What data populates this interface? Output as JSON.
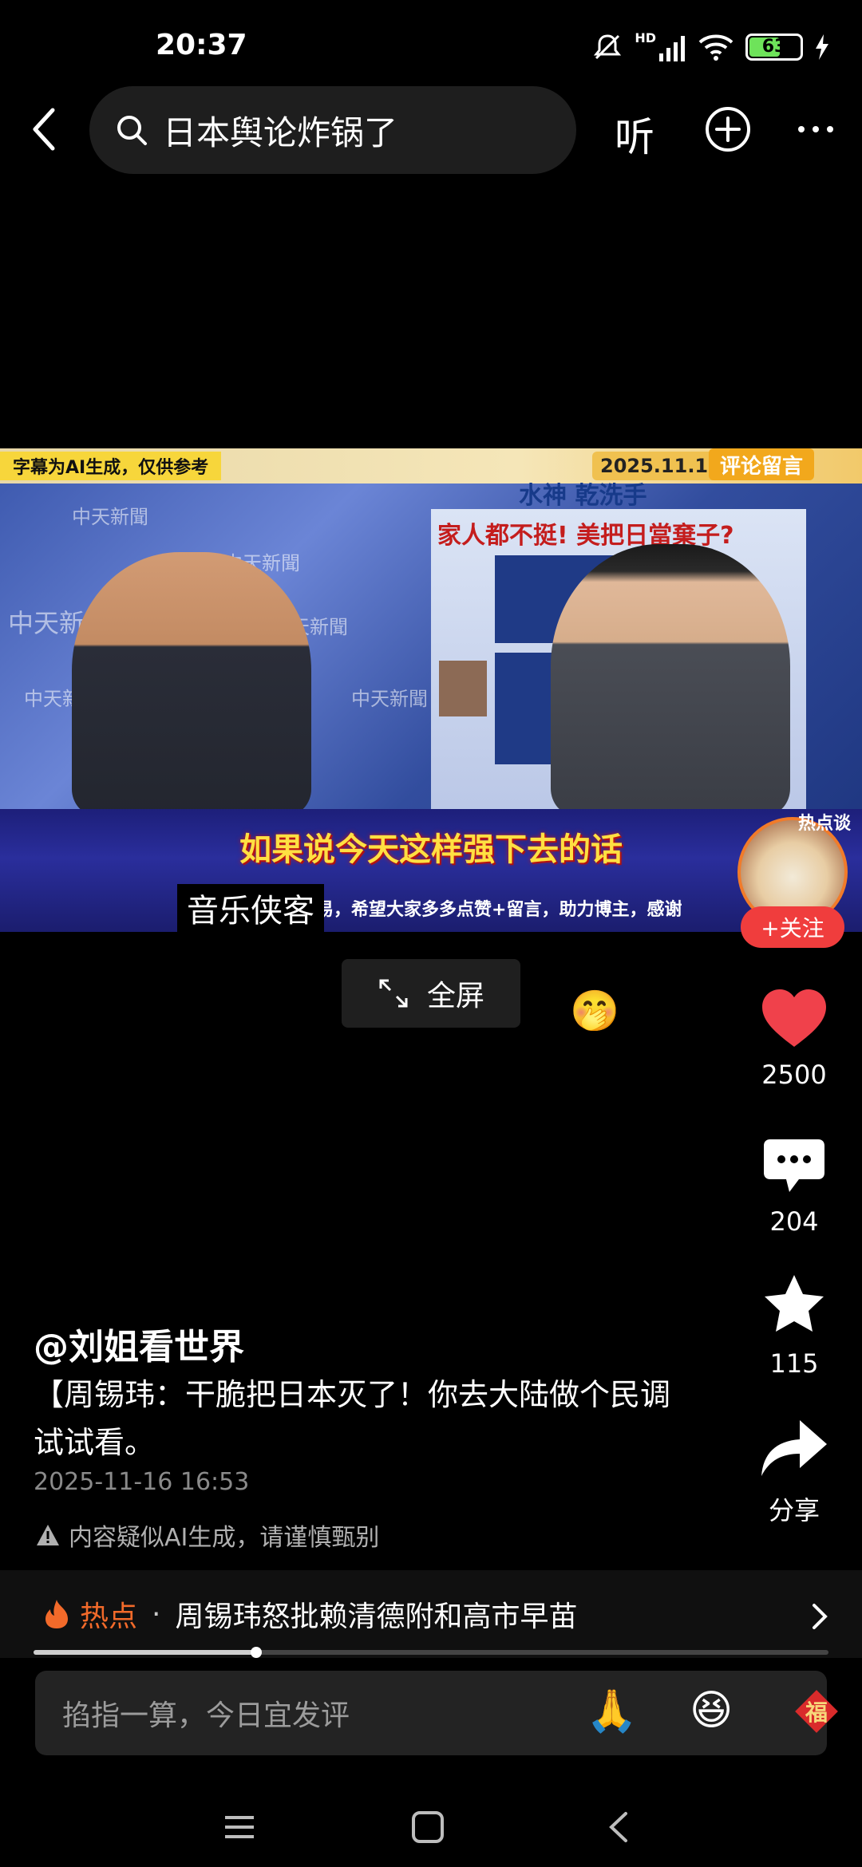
{
  "status_bar": {
    "time": "20:37",
    "network_label": "HD",
    "battery_level": 63,
    "battery_text": "63",
    "icons": [
      "mute-bell-icon",
      "signal-icon",
      "wifi-icon",
      "battery-icon",
      "charging-icon"
    ]
  },
  "header": {
    "back_icon": "chevron-left-icon",
    "search_icon": "search-icon",
    "search_query": "日本舆论炸锅了",
    "listen_label": "听",
    "add_icon": "plus-circle-icon",
    "more_icon": "more-dots-icon"
  },
  "video": {
    "ai_note": "字幕为AI生成，仅供参考",
    "date": "2025.11.14",
    "comment_tag": "评论留言",
    "sponsor": "水神 乾洗手",
    "channel": "中天新聞",
    "panel_title": "家人都不挺! 美把日當棄子?",
    "subtitle": "如果说今天这样强下去的话",
    "notice": "认准原创: 创作不易，希望大家多多点赞+留言，助力博主，感谢",
    "overlay_name": "音乐侠客",
    "hot_avatar_tag": "热点谈",
    "follow_label": "+关注",
    "fullscreen_label": "全屏",
    "colors": {
      "subtitle_yellow": "#ffe042",
      "banner_blue": "#1d1f7a",
      "follow_red": "#f03d3d"
    }
  },
  "actions": {
    "like": {
      "icon": "heart-icon",
      "count": "2500",
      "color": "#f0414b"
    },
    "comment": {
      "icon": "comment-bubble-icon",
      "count": "204"
    },
    "favorite": {
      "icon": "star-icon",
      "count": "115"
    },
    "share": {
      "icon": "share-arrow-icon",
      "label": "分享"
    }
  },
  "post": {
    "author": "@刘姐看世界",
    "caption": "【周锡玮：干脆把日本灭了！你去大陆做个民调试试看。",
    "date": "2025-11-16 16:53",
    "ai_warning": "内容疑似AI生成，请谨慎甄别"
  },
  "hot": {
    "icon": "fire-icon",
    "label": "热点",
    "separator": "·",
    "topic": "周锡玮怒批赖清德附和高市早苗",
    "chevron": "chevron-right-icon"
  },
  "progress": {
    "fraction": 0.28
  },
  "comment_bar": {
    "placeholder": "掐指一算，今日宜发评",
    "emojis": [
      "🙏",
      "😆"
    ],
    "fu_label": "福"
  },
  "nav": {
    "items": [
      "menu-icon",
      "home-square-icon",
      "back-arrow-icon"
    ]
  }
}
